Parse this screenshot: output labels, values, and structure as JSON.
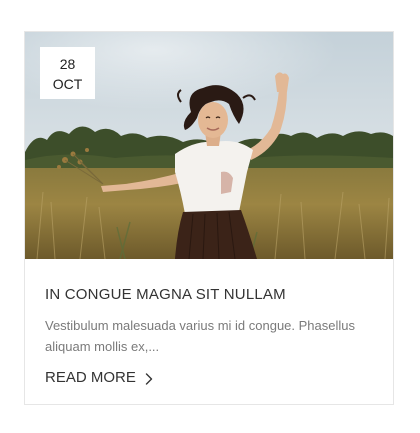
{
  "post": {
    "date_day": "28",
    "date_month": "OCT",
    "title": "IN CONGUE MAGNA SIT NULLAM",
    "excerpt": "Vestibulum malesuada varius mi id congue. Phasellus aliquam mollis ex,...",
    "read_more_label": "READ MORE",
    "image_alt": "woman dancing in a field"
  },
  "icons": {
    "read_more": "chevron-right-icon"
  }
}
